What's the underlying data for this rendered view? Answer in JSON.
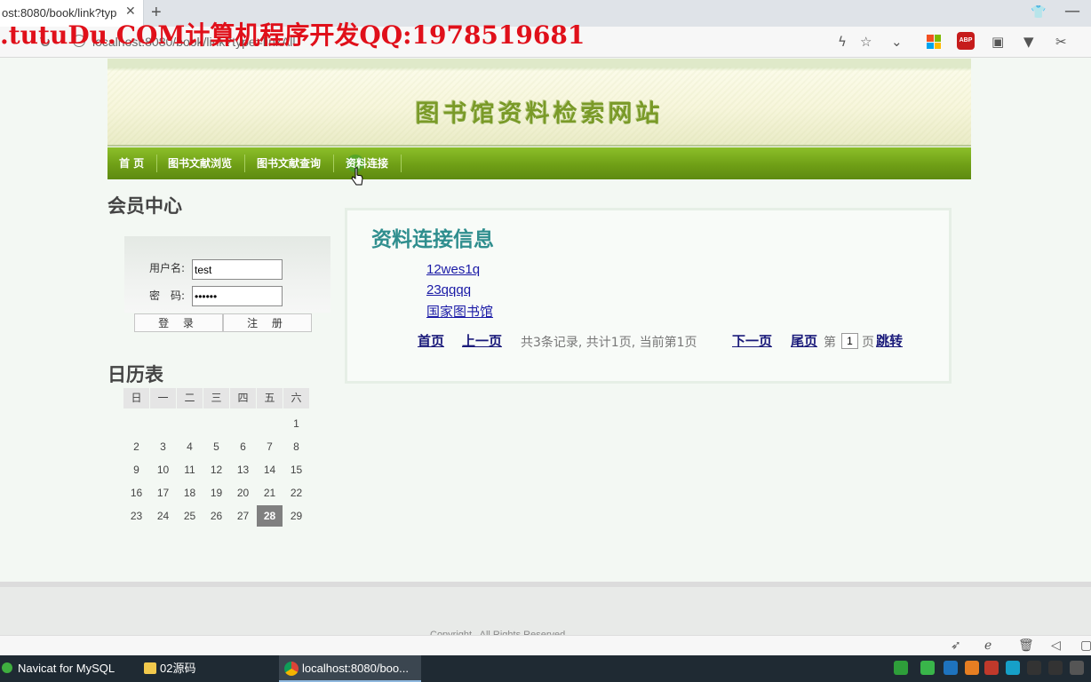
{
  "browser": {
    "tab_title": "ost:8080/book/link?typ",
    "tab_close": "✕",
    "new_tab": "+",
    "url": "localhost:8080/book/link?type=linkAll",
    "watermark": ".tutuDu.COM计算机程序开发QQ:1978519681"
  },
  "site": {
    "title": "图书馆资料检索网站",
    "nav": [
      "首 页",
      "图书文献浏览",
      "图书文献查询",
      "资料连接"
    ]
  },
  "member": {
    "title": "会员中心",
    "username_label": "用户名:",
    "password_label": "密　码:",
    "username_value": "test",
    "password_value": "••••••",
    "login_label": "登 录",
    "register_label": "注 册"
  },
  "calendar": {
    "title": "日历表",
    "weekdays": [
      "日",
      "一",
      "二",
      "三",
      "四",
      "五",
      "六"
    ],
    "today": "28",
    "weeks": [
      [
        "",
        "",
        "",
        "",
        "",
        "",
        "1"
      ],
      [
        "2",
        "3",
        "4",
        "5",
        "6",
        "7",
        "8"
      ],
      [
        "9",
        "10",
        "11",
        "12",
        "13",
        "14",
        "15"
      ],
      [
        "16",
        "17",
        "18",
        "19",
        "20",
        "21",
        "22"
      ],
      [
        "23",
        "24",
        "25",
        "26",
        "27",
        "28",
        "29"
      ]
    ]
  },
  "panel": {
    "title": "资料连接信息",
    "links": [
      "12wes1q",
      "23qqqq",
      "国家图书馆"
    ],
    "pager": {
      "first": "首页",
      "prev": "上一页",
      "summary": "共3条记录, 共计1页, 当前第1页",
      "next": "下一页",
      "last": "尾页",
      "page_prefix": "第",
      "page_value": "1",
      "page_suffix": "页",
      "jump": "跳转"
    }
  },
  "footer": {
    "copyright": "Copyright . All Rights Reserved"
  },
  "taskbar": {
    "items": [
      "Navicat for MySQL",
      "02源码",
      "localhost:8080/boo..."
    ]
  }
}
